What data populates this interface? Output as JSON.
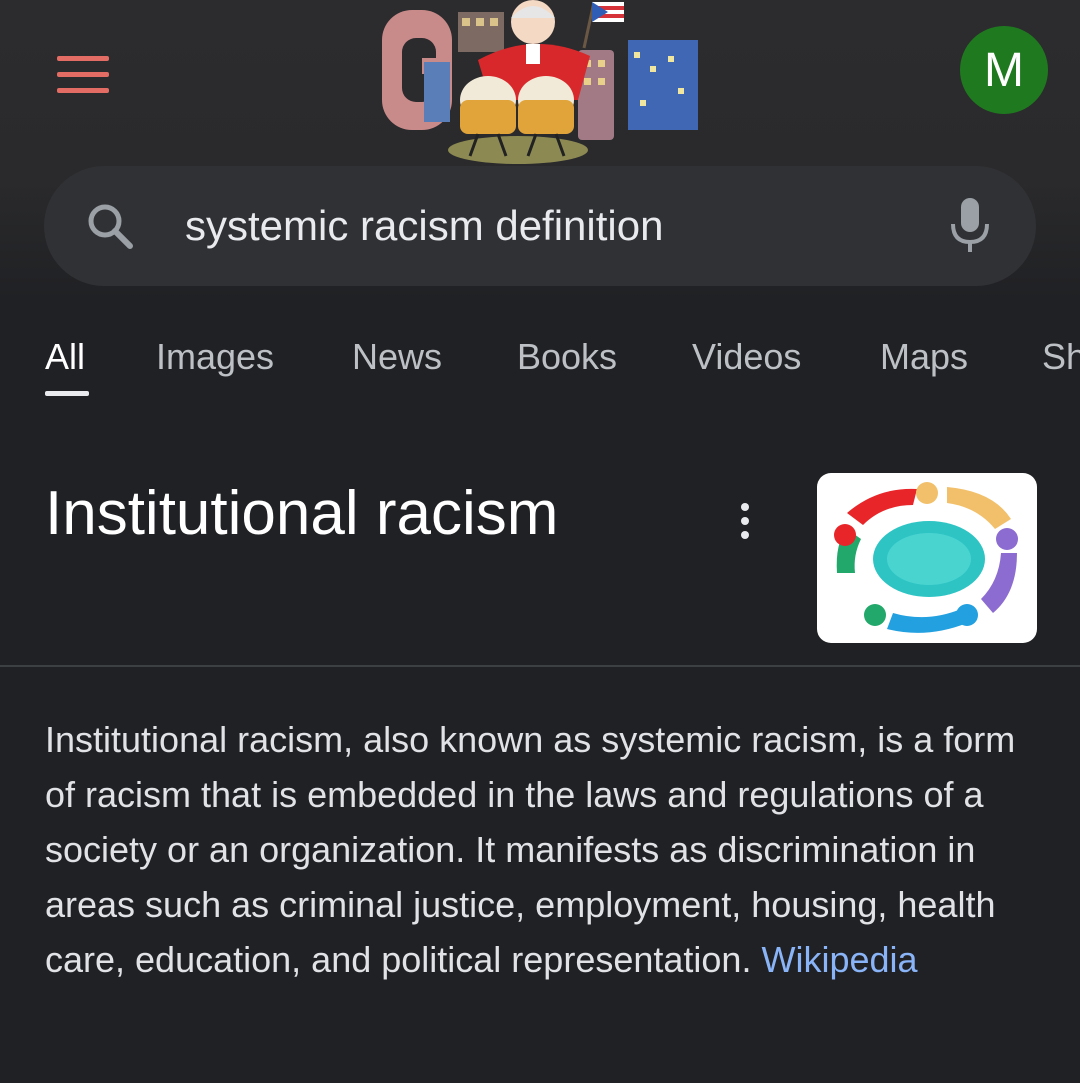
{
  "header": {
    "avatar_initial": "M",
    "menu_color": "#e36c64",
    "avatar_color": "#1f7a1f"
  },
  "search": {
    "query": "systemic racism definition"
  },
  "tabs": [
    {
      "label": "All",
      "active": true
    },
    {
      "label": "Images",
      "active": false
    },
    {
      "label": "News",
      "active": false
    },
    {
      "label": "Books",
      "active": false
    },
    {
      "label": "Videos",
      "active": false
    },
    {
      "label": "Maps",
      "active": false
    },
    {
      "label": "Sh",
      "active": false
    }
  ],
  "knowledge_panel": {
    "title": "Institutional racism",
    "description": "Institutional racism, also known as systemic racism, is a form of racism that is embedded in the laws and regulations of a society or an organization. It manifests as discrimination in areas such as criminal justice, employment, housing, health care, education, and political representation.",
    "source": "Wikipedia",
    "link_color": "#8ab4f8"
  }
}
